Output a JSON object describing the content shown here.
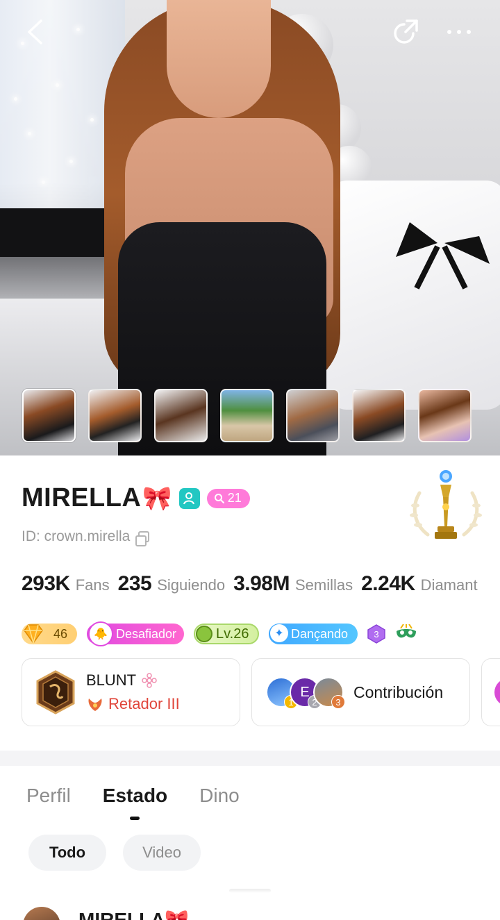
{
  "topbar": {
    "back_icon": "chevron-left-icon",
    "share_icon": "share-icon",
    "more_icon": "more-icon"
  },
  "gallery": {
    "thumbnail_count": 7,
    "active_index": 0
  },
  "profile": {
    "name": "MIRELLA",
    "name_emoji": "🎀",
    "fan_badge_count": "21",
    "id_text": "ID: crown.mirella",
    "stats": [
      {
        "value": "293K",
        "label": "Fans"
      },
      {
        "value": "235",
        "label": "Siguiendo"
      },
      {
        "value": "3.98M",
        "label": "Semillas"
      },
      {
        "value": "2.24K",
        "label": "Diamant"
      }
    ],
    "badges": {
      "diamond_level": "46",
      "challenger_label": "Desafiador",
      "level_label": "Lv.26",
      "dance_label": "Dançando",
      "hex_level": "3"
    },
    "rank_card": {
      "name": "BLUNT",
      "tier": "Retador III"
    },
    "contribution_card": {
      "label": "Contribución",
      "avatar_letter": "E",
      "ranks": [
        "1",
        "2",
        "3"
      ]
    }
  },
  "tabs": [
    {
      "label": "Perfil",
      "active": false
    },
    {
      "label": "Estado",
      "active": true
    },
    {
      "label": "Dino",
      "active": false
    }
  ],
  "filters": [
    {
      "label": "Todo",
      "active": true
    },
    {
      "label": "Video",
      "active": false
    }
  ],
  "post_preview": {
    "author": "MIRELLA🎀"
  },
  "colors": {
    "verified": "#22c7c2",
    "fan_badge": "#ff7ad9",
    "challenger": "#e04ae0",
    "level": "#8ac43d",
    "dance": "#3fa8ff",
    "tier_text": "#e0453a"
  }
}
